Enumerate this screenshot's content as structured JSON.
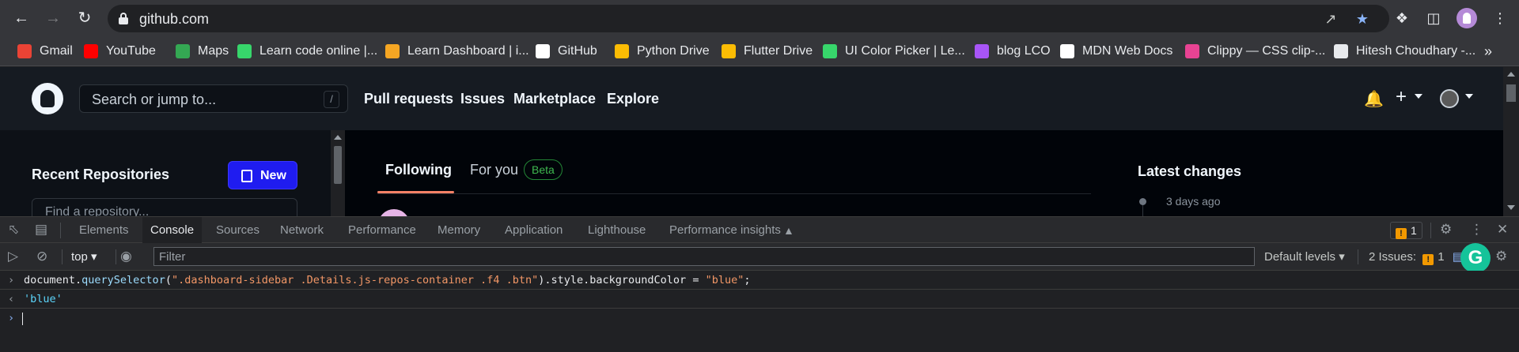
{
  "browser": {
    "url": "github.com",
    "bookmarks": [
      {
        "label": "Gmail",
        "icon": "gmail-icon",
        "color": "#ea4335"
      },
      {
        "label": "YouTube",
        "icon": "youtube-icon",
        "color": "#ff0000"
      },
      {
        "label": "Maps",
        "icon": "maps-icon",
        "color": "#34a853"
      },
      {
        "label": "Learn code online |...",
        "icon": "codepen-icon",
        "color": "#37d66b"
      },
      {
        "label": "Learn Dashboard | i...",
        "icon": "ineuron-icon",
        "color": "#f5a623"
      },
      {
        "label": "GitHub",
        "icon": "github-icon",
        "color": "#ffffff"
      },
      {
        "label": "Python Drive",
        "icon": "drive-icon",
        "color": "#fbbc04"
      },
      {
        "label": "Flutter Drive",
        "icon": "drive-icon",
        "color": "#fbbc04"
      },
      {
        "label": "UI Color Picker | Le...",
        "icon": "codepen-icon",
        "color": "#37d66b"
      },
      {
        "label": "blog LCO",
        "icon": "lco-icon",
        "color": "#a855f7"
      },
      {
        "label": "MDN Web Docs",
        "icon": "mdn-icon",
        "color": "#ffffff"
      },
      {
        "label": "Clippy — CSS clip-...",
        "icon": "clippy-icon",
        "color": "#e84393"
      },
      {
        "label": "Hitesh Choudhary -...",
        "icon": "page-icon",
        "color": "#e8eaed"
      }
    ],
    "bookmarks_more": "»"
  },
  "github": {
    "search_placeholder": "Search or jump to...",
    "search_shortcut": "/",
    "nav": [
      "Pull requests",
      "Issues",
      "Marketplace",
      "Explore"
    ],
    "plus": "+",
    "sidebar": {
      "title": "Recent Repositories",
      "new_button": "New",
      "find_placeholder": "Find a repository..."
    },
    "tabs": {
      "following": "Following",
      "for_you": "For you",
      "beta": "Beta"
    },
    "latest": {
      "title": "Latest changes",
      "date": "3 days ago"
    }
  },
  "devtools": {
    "tabs": [
      "Elements",
      "Console",
      "Sources",
      "Network",
      "Performance",
      "Memory",
      "Application",
      "Lighthouse",
      "Performance insights"
    ],
    "active_tab": "Console",
    "warning_count": "1",
    "context": "top",
    "filter_placeholder": "Filter",
    "levels": "Default levels",
    "issues_label": "2 Issues:",
    "issues_warn": "1",
    "issues_info": "1",
    "console": {
      "input_prefix": "document.",
      "input_fn": "querySelector",
      "input_open": "(",
      "input_selector": "\".dashboard-sidebar .Details.js-repos-container .f4 .btn\"",
      "input_mid": ").style.backgroundColor = ",
      "input_value": "\"blue\"",
      "input_end": ";",
      "result": "'blue'"
    }
  }
}
